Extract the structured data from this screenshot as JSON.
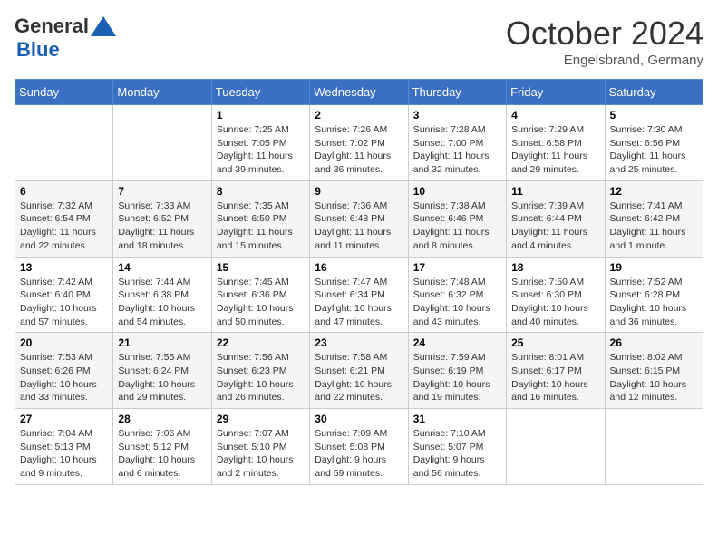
{
  "header": {
    "logo": {
      "general": "General",
      "blue": "Blue"
    },
    "title": "October 2024",
    "location": "Engelsbrand, Germany"
  },
  "weekdays": [
    "Sunday",
    "Monday",
    "Tuesday",
    "Wednesday",
    "Thursday",
    "Friday",
    "Saturday"
  ],
  "weeks": [
    [
      {
        "day": "",
        "info": ""
      },
      {
        "day": "",
        "info": ""
      },
      {
        "day": "1",
        "info": "Sunrise: 7:25 AM\nSunset: 7:05 PM\nDaylight: 11 hours and 39 minutes."
      },
      {
        "day": "2",
        "info": "Sunrise: 7:26 AM\nSunset: 7:02 PM\nDaylight: 11 hours and 36 minutes."
      },
      {
        "day": "3",
        "info": "Sunrise: 7:28 AM\nSunset: 7:00 PM\nDaylight: 11 hours and 32 minutes."
      },
      {
        "day": "4",
        "info": "Sunrise: 7:29 AM\nSunset: 6:58 PM\nDaylight: 11 hours and 29 minutes."
      },
      {
        "day": "5",
        "info": "Sunrise: 7:30 AM\nSunset: 6:56 PM\nDaylight: 11 hours and 25 minutes."
      }
    ],
    [
      {
        "day": "6",
        "info": "Sunrise: 7:32 AM\nSunset: 6:54 PM\nDaylight: 11 hours and 22 minutes."
      },
      {
        "day": "7",
        "info": "Sunrise: 7:33 AM\nSunset: 6:52 PM\nDaylight: 11 hours and 18 minutes."
      },
      {
        "day": "8",
        "info": "Sunrise: 7:35 AM\nSunset: 6:50 PM\nDaylight: 11 hours and 15 minutes."
      },
      {
        "day": "9",
        "info": "Sunrise: 7:36 AM\nSunset: 6:48 PM\nDaylight: 11 hours and 11 minutes."
      },
      {
        "day": "10",
        "info": "Sunrise: 7:38 AM\nSunset: 6:46 PM\nDaylight: 11 hours and 8 minutes."
      },
      {
        "day": "11",
        "info": "Sunrise: 7:39 AM\nSunset: 6:44 PM\nDaylight: 11 hours and 4 minutes."
      },
      {
        "day": "12",
        "info": "Sunrise: 7:41 AM\nSunset: 6:42 PM\nDaylight: 11 hours and 1 minute."
      }
    ],
    [
      {
        "day": "13",
        "info": "Sunrise: 7:42 AM\nSunset: 6:40 PM\nDaylight: 10 hours and 57 minutes."
      },
      {
        "day": "14",
        "info": "Sunrise: 7:44 AM\nSunset: 6:38 PM\nDaylight: 10 hours and 54 minutes."
      },
      {
        "day": "15",
        "info": "Sunrise: 7:45 AM\nSunset: 6:36 PM\nDaylight: 10 hours and 50 minutes."
      },
      {
        "day": "16",
        "info": "Sunrise: 7:47 AM\nSunset: 6:34 PM\nDaylight: 10 hours and 47 minutes."
      },
      {
        "day": "17",
        "info": "Sunrise: 7:48 AM\nSunset: 6:32 PM\nDaylight: 10 hours and 43 minutes."
      },
      {
        "day": "18",
        "info": "Sunrise: 7:50 AM\nSunset: 6:30 PM\nDaylight: 10 hours and 40 minutes."
      },
      {
        "day": "19",
        "info": "Sunrise: 7:52 AM\nSunset: 6:28 PM\nDaylight: 10 hours and 36 minutes."
      }
    ],
    [
      {
        "day": "20",
        "info": "Sunrise: 7:53 AM\nSunset: 6:26 PM\nDaylight: 10 hours and 33 minutes."
      },
      {
        "day": "21",
        "info": "Sunrise: 7:55 AM\nSunset: 6:24 PM\nDaylight: 10 hours and 29 minutes."
      },
      {
        "day": "22",
        "info": "Sunrise: 7:56 AM\nSunset: 6:23 PM\nDaylight: 10 hours and 26 minutes."
      },
      {
        "day": "23",
        "info": "Sunrise: 7:58 AM\nSunset: 6:21 PM\nDaylight: 10 hours and 22 minutes."
      },
      {
        "day": "24",
        "info": "Sunrise: 7:59 AM\nSunset: 6:19 PM\nDaylight: 10 hours and 19 minutes."
      },
      {
        "day": "25",
        "info": "Sunrise: 8:01 AM\nSunset: 6:17 PM\nDaylight: 10 hours and 16 minutes."
      },
      {
        "day": "26",
        "info": "Sunrise: 8:02 AM\nSunset: 6:15 PM\nDaylight: 10 hours and 12 minutes."
      }
    ],
    [
      {
        "day": "27",
        "info": "Sunrise: 7:04 AM\nSunset: 5:13 PM\nDaylight: 10 hours and 9 minutes."
      },
      {
        "day": "28",
        "info": "Sunrise: 7:06 AM\nSunset: 5:12 PM\nDaylight: 10 hours and 6 minutes."
      },
      {
        "day": "29",
        "info": "Sunrise: 7:07 AM\nSunset: 5:10 PM\nDaylight: 10 hours and 2 minutes."
      },
      {
        "day": "30",
        "info": "Sunrise: 7:09 AM\nSunset: 5:08 PM\nDaylight: 9 hours and 59 minutes."
      },
      {
        "day": "31",
        "info": "Sunrise: 7:10 AM\nSunset: 5:07 PM\nDaylight: 9 hours and 56 minutes."
      },
      {
        "day": "",
        "info": ""
      },
      {
        "day": "",
        "info": ""
      }
    ]
  ]
}
